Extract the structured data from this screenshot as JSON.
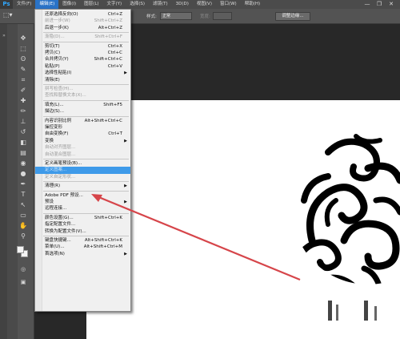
{
  "app": {
    "logo": "Ps"
  },
  "menubar": {
    "items": [
      {
        "label": "文件(F)"
      },
      {
        "label": "编辑(E)"
      },
      {
        "label": "图像(I)"
      },
      {
        "label": "图层(L)"
      },
      {
        "label": "文字(Y)"
      },
      {
        "label": "选择(S)"
      },
      {
        "label": "滤镜(T)"
      },
      {
        "label": "3D(D)"
      },
      {
        "label": "视图(V)"
      },
      {
        "label": "窗口(W)"
      },
      {
        "label": "帮助(H)"
      }
    ],
    "active": "编辑(E)",
    "window_controls": [
      "—",
      "❐",
      "✕"
    ]
  },
  "options": {
    "style_label": "样式:",
    "style_value": "正常",
    "width_label": "宽度:",
    "adjust_edge_button": "调整边缘..."
  },
  "edit_menu": {
    "items": [
      {
        "label": "还原选择反向(O)",
        "shortcut": "Ctrl+Z",
        "state": "normal"
      },
      {
        "label": "前进一步(W)",
        "shortcut": "Shift+Ctrl+Z",
        "state": "disabled"
      },
      {
        "label": "后退一步(K)",
        "shortcut": "Alt+Ctrl+Z",
        "state": "normal"
      },
      {
        "sep": true
      },
      {
        "label": "渐隐(D)...",
        "shortcut": "Shift+Ctrl+F",
        "state": "disabled"
      },
      {
        "sep": true
      },
      {
        "label": "剪切(T)",
        "shortcut": "Ctrl+X",
        "state": "normal"
      },
      {
        "label": "拷贝(C)",
        "shortcut": "Ctrl+C",
        "state": "normal"
      },
      {
        "label": "合并拷贝(Y)",
        "shortcut": "Shift+Ctrl+C",
        "state": "normal"
      },
      {
        "label": "粘贴(P)",
        "shortcut": "Ctrl+V",
        "state": "normal"
      },
      {
        "label": "选择性粘贴(I)",
        "shortcut": "",
        "state": "normal",
        "submenu": true
      },
      {
        "label": "清除(E)",
        "shortcut": "",
        "state": "normal"
      },
      {
        "sep": true
      },
      {
        "label": "拼写检查(H)...",
        "shortcut": "",
        "state": "disabled"
      },
      {
        "label": "查找和替换文本(X)...",
        "shortcut": "",
        "state": "disabled"
      },
      {
        "sep": true
      },
      {
        "label": "填充(L)...",
        "shortcut": "Shift+F5",
        "state": "normal"
      },
      {
        "label": "描边(S)...",
        "shortcut": "",
        "state": "normal"
      },
      {
        "sep": true
      },
      {
        "label": "内容识别比例",
        "shortcut": "Alt+Shift+Ctrl+C",
        "state": "normal"
      },
      {
        "label": "操控变形",
        "shortcut": "",
        "state": "normal"
      },
      {
        "label": "自由变换(F)",
        "shortcut": "Ctrl+T",
        "state": "normal"
      },
      {
        "label": "变换",
        "shortcut": "",
        "state": "normal",
        "submenu": true
      },
      {
        "label": "自动对齐图层...",
        "shortcut": "",
        "state": "disabled"
      },
      {
        "label": "自动混合图层...",
        "shortcut": "",
        "state": "disabled"
      },
      {
        "sep": true
      },
      {
        "label": "定义画笔预设(B)...",
        "shortcut": "",
        "state": "normal"
      },
      {
        "label": "定义图案...",
        "shortcut": "",
        "state": "hover"
      },
      {
        "label": "定义自定形状...",
        "shortcut": "",
        "state": "disabled"
      },
      {
        "sep": true
      },
      {
        "label": "清理(R)",
        "shortcut": "",
        "state": "normal",
        "submenu": true
      },
      {
        "sep": true
      },
      {
        "label": "Adobe PDF 预设...",
        "shortcut": "",
        "state": "normal"
      },
      {
        "label": "预设",
        "shortcut": "",
        "state": "normal",
        "submenu": true
      },
      {
        "label": "远程连接...",
        "shortcut": "",
        "state": "normal"
      },
      {
        "sep": true
      },
      {
        "label": "颜色设置(G)...",
        "shortcut": "Shift+Ctrl+K",
        "state": "normal"
      },
      {
        "label": "指定配置文件...",
        "shortcut": "",
        "state": "normal"
      },
      {
        "label": "转换为配置文件(V)...",
        "shortcut": "",
        "state": "normal"
      },
      {
        "sep": true
      },
      {
        "label": "键盘快捷键...",
        "shortcut": "Alt+Shift+Ctrl+K",
        "state": "normal"
      },
      {
        "label": "菜单(U)...",
        "shortcut": "Alt+Shift+Ctrl+M",
        "state": "normal"
      },
      {
        "label": "首选项(N)",
        "shortcut": "",
        "state": "normal",
        "submenu": true
      }
    ]
  },
  "tools": {
    "icons": [
      "move-icon",
      "marquee-icon",
      "lasso-icon",
      "quick-select-icon",
      "crop-icon",
      "eyedropper-icon",
      "healing-icon",
      "brush-icon",
      "stamp-icon",
      "history-brush-icon",
      "eraser-icon",
      "gradient-icon",
      "blur-icon",
      "dodge-icon",
      "pen-icon",
      "type-icon",
      "path-select-icon",
      "shape-icon",
      "hand-icon",
      "zoom-icon"
    ],
    "glyphs": [
      "✥",
      "⬚",
      "ʘ",
      "✎",
      "⌗",
      "✐",
      "✚",
      "✏",
      "⊥",
      "↺",
      "◧",
      "▤",
      "◉",
      "●",
      "✒",
      "T",
      "↖",
      "▭",
      "✋",
      "⚲"
    ]
  },
  "colors": {
    "accent": "#3e9ae9",
    "arrow": "#d6454a"
  }
}
